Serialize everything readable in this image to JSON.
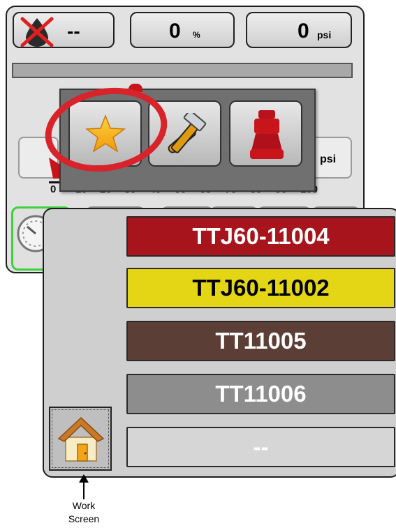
{
  "status_bar": {
    "product_value": "--",
    "percent_value": "0",
    "percent_unit": "%",
    "pressure_value": "0",
    "pressure_unit": "psi"
  },
  "gauge": {
    "unit": "psi",
    "tick_labels": [
      "0",
      "10",
      "20",
      "30",
      "40",
      "50",
      "60",
      "70",
      "80",
      "90",
      "100"
    ]
  },
  "menu": {
    "items": [
      {
        "name": "favorites",
        "icon": "star-icon"
      },
      {
        "name": "tools",
        "icon": "hammer-wrench-icon"
      },
      {
        "name": "nozzle",
        "icon": "nozzle-icon"
      }
    ],
    "highlighted": "favorites"
  },
  "tips": [
    {
      "label": "TTJ60-11004",
      "bg": "#a8141b",
      "fg": "#ffffff"
    },
    {
      "label": "TTJ60-11002",
      "bg": "#e4d614",
      "fg": "#000000"
    },
    {
      "label": "TT11005",
      "bg": "#5b3e35",
      "fg": "#ffffff"
    },
    {
      "label": "TT11006",
      "bg": "#8d8d8d",
      "fg": "#ffffff"
    },
    {
      "label": "--",
      "bg": "#d6d6d6",
      "fg": "#ffffff"
    }
  ],
  "home_button_icon": "home-icon",
  "callout": {
    "line1": "Work",
    "line2": "Screen"
  }
}
